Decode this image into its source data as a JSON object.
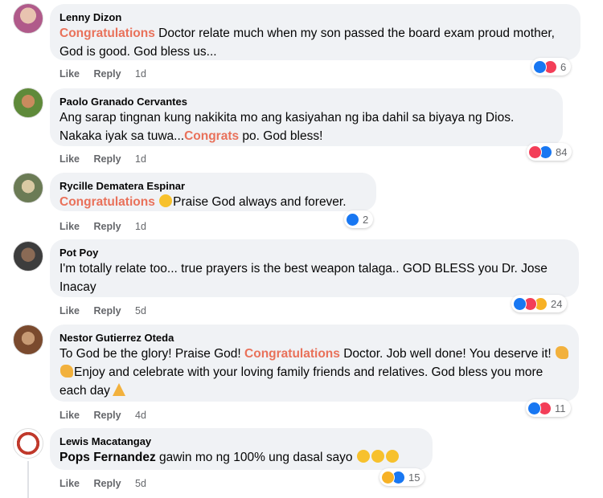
{
  "actions": {
    "like": "Like",
    "reply": "Reply"
  },
  "comments": [
    {
      "author": "Lenny Dizon",
      "highlight": "Congratulations",
      "text": " Doctor relate much when my son passed the board exam proud mother, God is good. God bless us...",
      "time": "1d",
      "reaction_icons": [
        "like-icon",
        "love-icon"
      ],
      "reaction_count": "6"
    },
    {
      "author": "Paolo Granado Cervantes",
      "text_before": "Ang sarap tingnan kung nakikita mo ang kasiyahan ng iba dahil sa biyaya ng Dios. Nakaka iyak sa tuwa...",
      "highlight": "Congrats",
      "text_after": " po. God bless!",
      "time": "1d",
      "reaction_icons": [
        "love-icon",
        "like-icon"
      ],
      "reaction_count": "84"
    },
    {
      "author": "Rycille Dematera Espinar",
      "highlight": "Congratulations",
      "emoji": "smile-emoji",
      "text": "Praise God always and forever.",
      "time": "1d",
      "reaction_icons": [
        "like-icon"
      ],
      "reaction_count": "2"
    },
    {
      "author": "Pot Poy",
      "text": "I'm totally relate too... true prayers is the best weapon talaga.. GOD BLESS you Dr. Jose Inacay",
      "time": "5d",
      "reaction_icons": [
        "like-icon",
        "love-icon",
        "care-icon"
      ],
      "reaction_count": "24"
    },
    {
      "author": "Nestor Gutierrez Oteda",
      "text_before": "To God be the glory! Praise God! ",
      "highlight": "Congratulations",
      "text_mid": " Doctor. Job well done! You deserve it! ",
      "text_after": "Enjoy and celebrate with your loving family friends and relatives. God bless you more each day",
      "time": "4d",
      "reaction_icons": [
        "like-icon",
        "love-icon"
      ],
      "reaction_count": "11"
    },
    {
      "author": "Lewis Macatangay",
      "tag": "Pops Fernandez",
      "text": " gawin mo ng 100% ung dasal sayo",
      "time": "5d",
      "reaction_icons": [
        "haha-icon",
        "like-icon"
      ],
      "reaction_count": "15"
    }
  ],
  "colors": {
    "highlight": "#e9715a",
    "bubble": "#f0f2f5",
    "like": "#1877f2",
    "love": "#f33e58",
    "haha": "#f7b125"
  }
}
